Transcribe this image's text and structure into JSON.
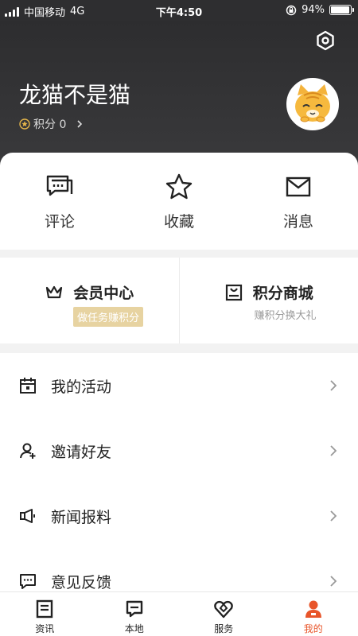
{
  "status_bar": {
    "carrier": "中国移动",
    "network": "4G",
    "time": "下午4:50",
    "battery_percent": "94%",
    "battery_level": 0.94
  },
  "header": {
    "username": "龙猫不是猫",
    "points_label": "积分 0",
    "settings_icon": "gear-hexagon-icon",
    "avatar": "cartoon-cat-avatar"
  },
  "shortcuts": [
    {
      "label": "评论",
      "icon": "comment-icon"
    },
    {
      "label": "收藏",
      "icon": "star-icon"
    },
    {
      "label": "消息",
      "icon": "mail-icon"
    }
  ],
  "member": {
    "vip": {
      "title": "会员中心",
      "subtitle": "做任务赚积分",
      "icon": "crown-icon"
    },
    "mall": {
      "title": "积分商城",
      "subtitle": "赚积分换大礼",
      "icon": "mall-icon"
    }
  },
  "menu": [
    {
      "label": "我的活动",
      "icon": "calendar-icon"
    },
    {
      "label": "邀请好友",
      "icon": "add-user-icon"
    },
    {
      "label": "新闻报料",
      "icon": "megaphone-icon"
    },
    {
      "label": "意见反馈",
      "icon": "feedback-icon"
    }
  ],
  "tabs": [
    {
      "label": "资讯",
      "icon": "news-icon",
      "active": false
    },
    {
      "label": "本地",
      "icon": "local-icon",
      "active": false
    },
    {
      "label": "服务",
      "icon": "service-icon",
      "active": false
    },
    {
      "label": "我的",
      "icon": "profile-icon",
      "active": true
    }
  ],
  "colors": {
    "header_bg": "#2d2d2f",
    "accent": "#e8552a",
    "badge_gold": "#e7d3a1"
  }
}
